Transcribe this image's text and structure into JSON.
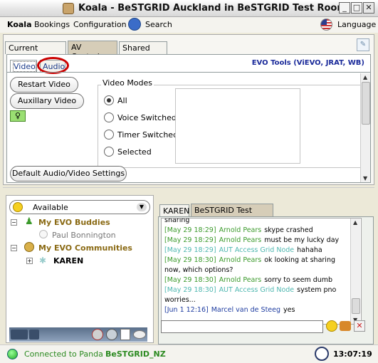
{
  "window": {
    "title": "Koala - BeSTGRID Auckland in BeSTGRID Test Room"
  },
  "menu": {
    "items": [
      "Koala",
      "Bookings",
      "Configuration"
    ],
    "search": "Search",
    "language": "Language"
  },
  "tabs": [
    "Current Meeting",
    "AV Controls",
    "Shared Files"
  ],
  "av": {
    "subtabs": [
      "Video",
      "Audio"
    ],
    "evo_tools": "EVO Tools (ViEVO, JRAT, WB)",
    "buttons": {
      "restart": "Restart Video",
      "auxiliary": "Auxillary Video",
      "defaults": "Default Audio/Video Settings"
    },
    "video_modes": {
      "legend": "Video Modes",
      "options": [
        "All",
        "Voice Switched",
        "Timer Switched",
        "Selected"
      ],
      "selected": "All"
    }
  },
  "presence": {
    "status": "Available"
  },
  "tree": {
    "buddies_label": "My EVO Buddies",
    "buddy": "Paul Bonnington",
    "communities_label": "My EVO Communities",
    "community": "KAREN"
  },
  "chat": {
    "tabs": [
      "KAREN",
      "BeSTGRID Test Room"
    ],
    "lines": [
      {
        "time": "",
        "name": "",
        "text": "sharing"
      },
      {
        "time": "[May 29 18:29]",
        "name": "Arnold Pears",
        "text": "skype crashed"
      },
      {
        "time": "[May 29 18:29]",
        "name": "Arnold Pears",
        "text": "must be my lucky day"
      },
      {
        "time": "[May 29 18:29]",
        "name": "AUT Access Grid Node",
        "text": "hahaha"
      },
      {
        "time": "[May 29 18:30]",
        "name": "Arnold Pears",
        "text": "ok looking at sharing"
      },
      {
        "time": "",
        "name": "",
        "text": "now, which options?"
      },
      {
        "time": "[May 29 18:30]",
        "name": "Arnold Pears",
        "text": "sorry to seem dumb"
      },
      {
        "time": "[May 29 18:30]",
        "name": "AUT Access Grid Node",
        "text": "system pno"
      },
      {
        "time": "",
        "name": "",
        "text": "worries..."
      },
      {
        "time": "[Jun 1 12:16]",
        "name": "Marcel van de Steeg",
        "text": "yes"
      }
    ]
  },
  "statusbar": {
    "connected_prefix": "Connected to Panda",
    "server": "BeSTGRID_NZ",
    "clock": "13:07:19"
  },
  "colors": {
    "green_name": "#3c9a2c",
    "cyan_name": "#4fb7b0",
    "blue_name": "#1e3ca0",
    "highlight_red": "#cc0000"
  }
}
